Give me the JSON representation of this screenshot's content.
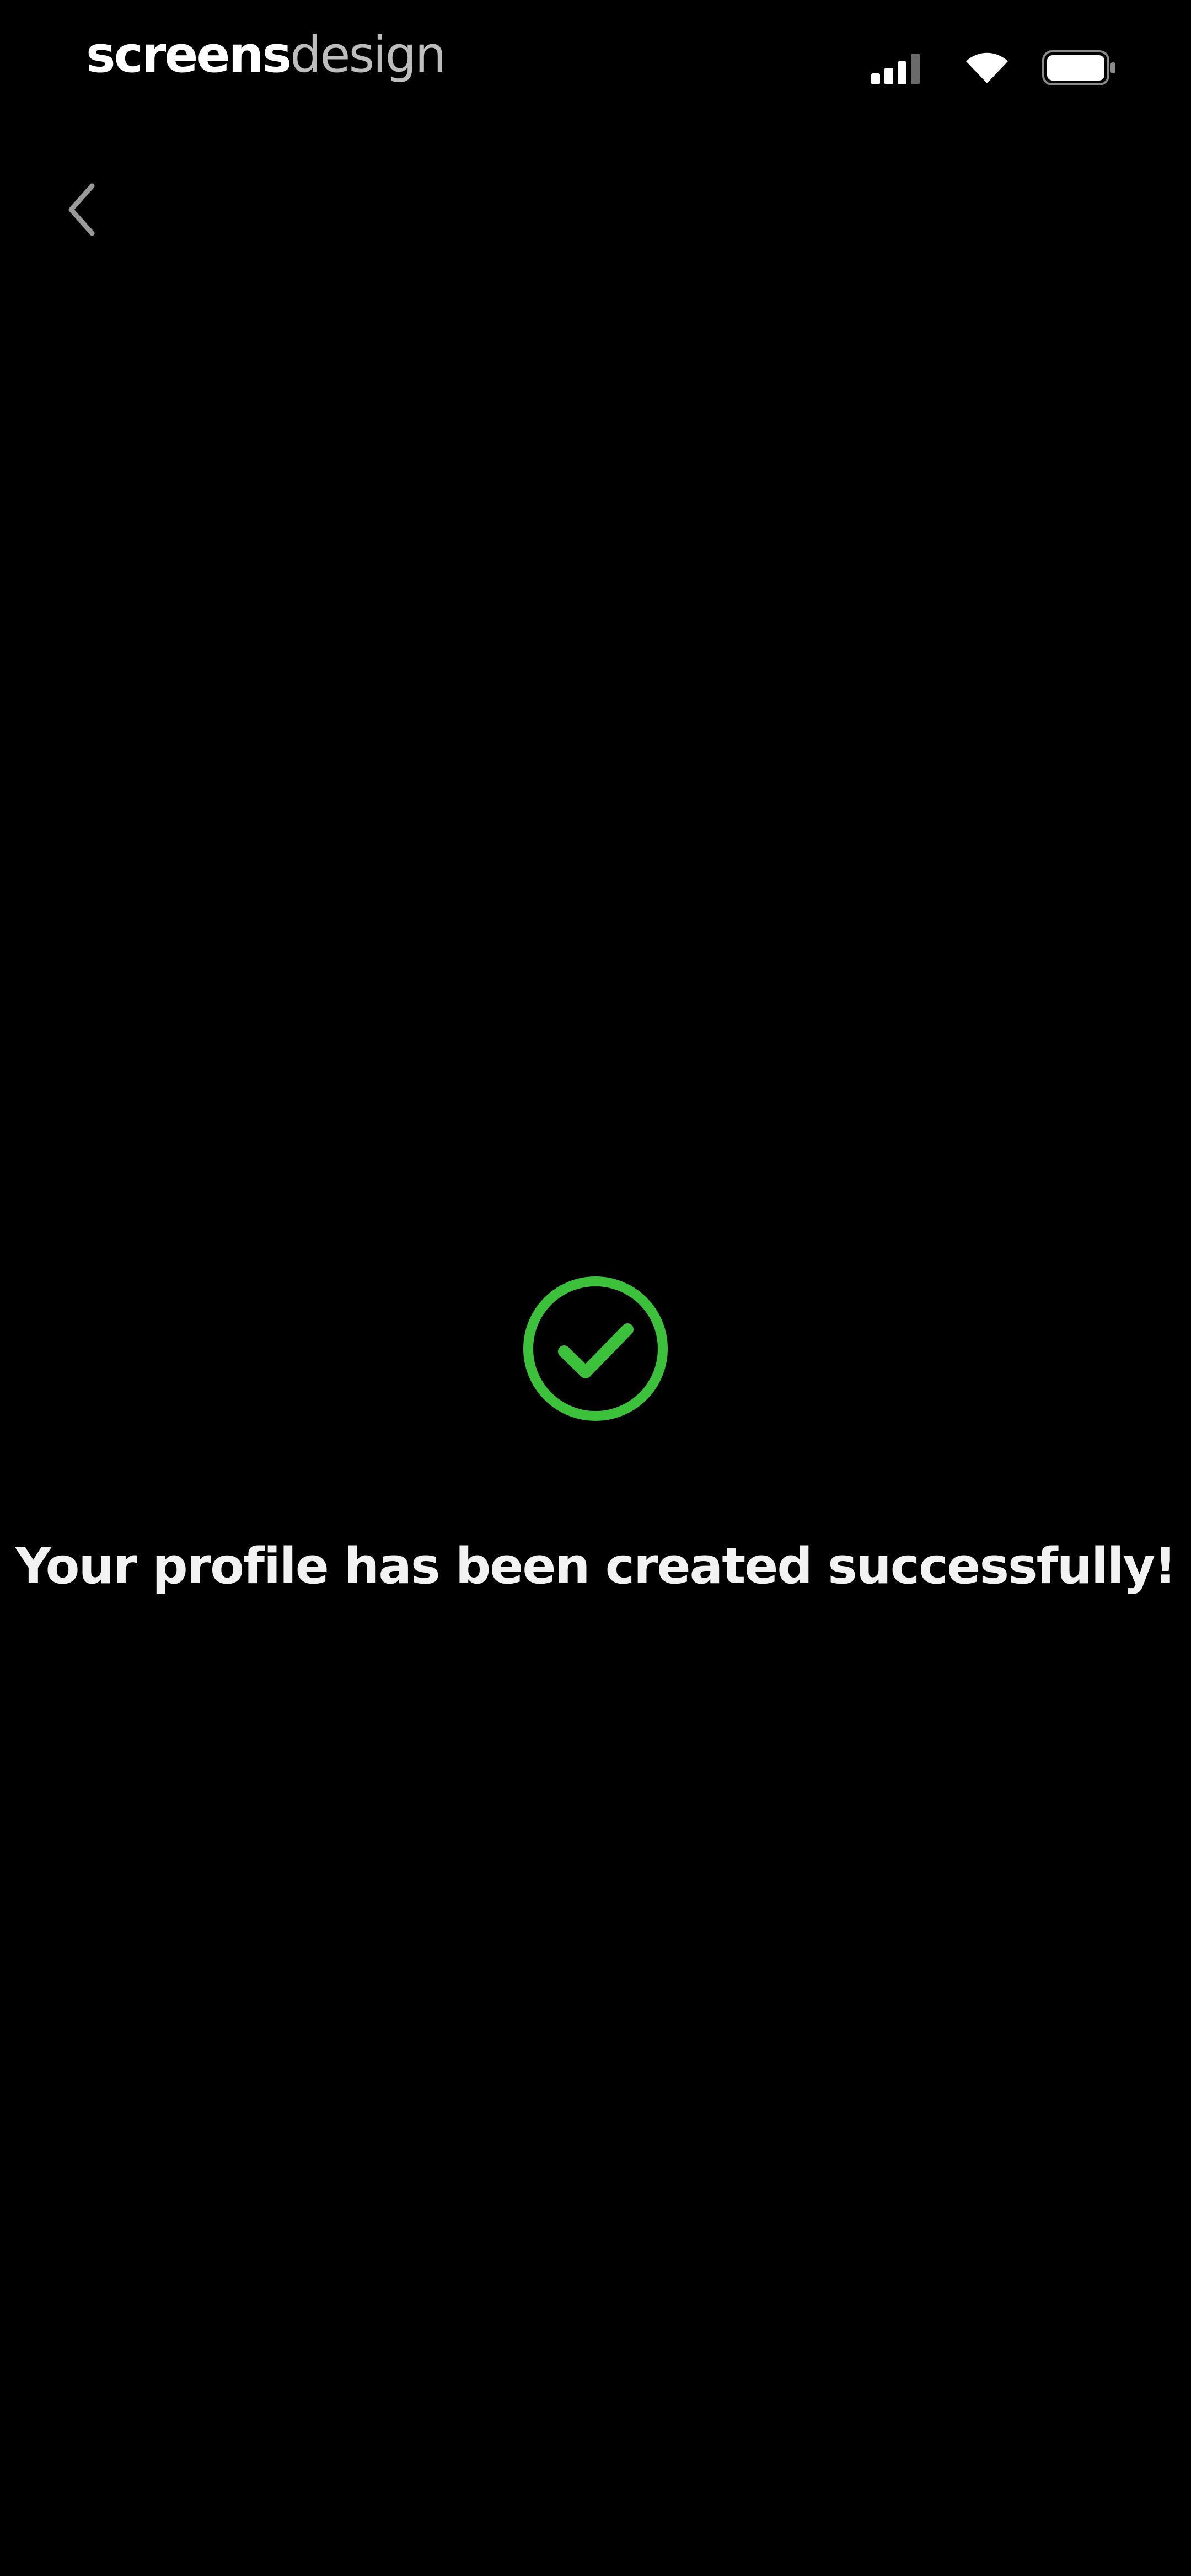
{
  "status_bar": {
    "brand_bold": "screens",
    "brand_light": "design",
    "icons": [
      "signal-icon",
      "wifi-icon",
      "battery-icon"
    ]
  },
  "nav": {
    "back_icon": "chevron-left-icon"
  },
  "success": {
    "icon": "check-circle-icon",
    "message": "Your profile has been created successfully!"
  },
  "colors": {
    "background": "#000000",
    "text": "#f2f2f2",
    "accent_green": "#3cc13b"
  }
}
